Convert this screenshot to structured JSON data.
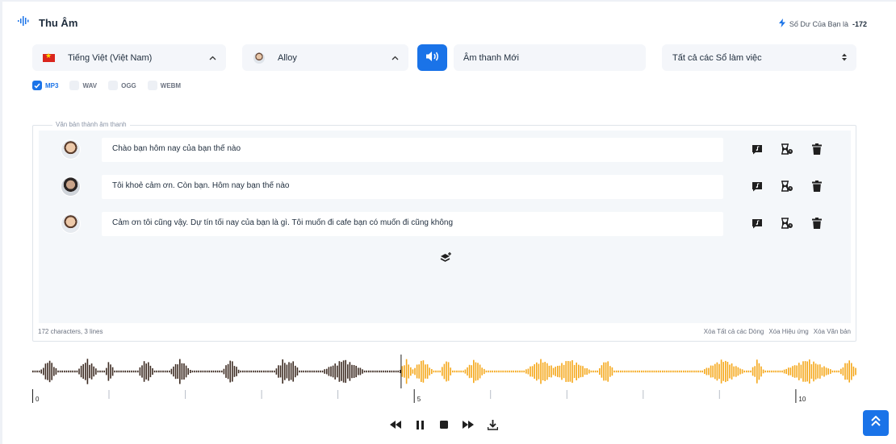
{
  "header": {
    "title": "Thu Âm",
    "balance_label": "Số Dư Của Bạn là",
    "balance_value": "-172",
    "logo_icon": "waveform-icon",
    "balance_icon": "lightning-icon"
  },
  "controls_row": {
    "language": "Tiếng Việt (Việt Nam)",
    "voice": "Alloy",
    "sound_name": "Âm thanh Mới",
    "workspace": "Tất cả các Sổ làm việc"
  },
  "formats": [
    {
      "label": "MP3",
      "checked": true
    },
    {
      "label": "WAV",
      "checked": false
    },
    {
      "label": "OGG",
      "checked": false
    },
    {
      "label": "WEBM",
      "checked": false
    }
  ],
  "editor": {
    "legend": "Văn bản thành âm thanh",
    "lines": [
      {
        "text": "Chào bạn hôm nay của bạn thế nào"
      },
      {
        "text": "Tôi khoẻ cảm ơn. Còn bạn. Hôm nay bạn thế nào"
      },
      {
        "text": "Cảm ơn tôi cũng vậy. Dự tín tối nay của bạn là gì. Tôi muốn đi cafe bạn có muốn đi cũng không"
      }
    ],
    "stats": "172 characters, 3 lines",
    "clear_lines": "Xóa Tất cả các Dòng",
    "clear_effects": "Xóa Hiệu ứng",
    "clear_text": "Xóa Văn bản"
  },
  "timeline": {
    "ticks": [
      "0",
      "5",
      "10"
    ],
    "played_fraction": 0.447,
    "colors": {
      "played": "#3d2b22",
      "remaining": "#f5a81c",
      "accent": "#1a73e8"
    }
  }
}
